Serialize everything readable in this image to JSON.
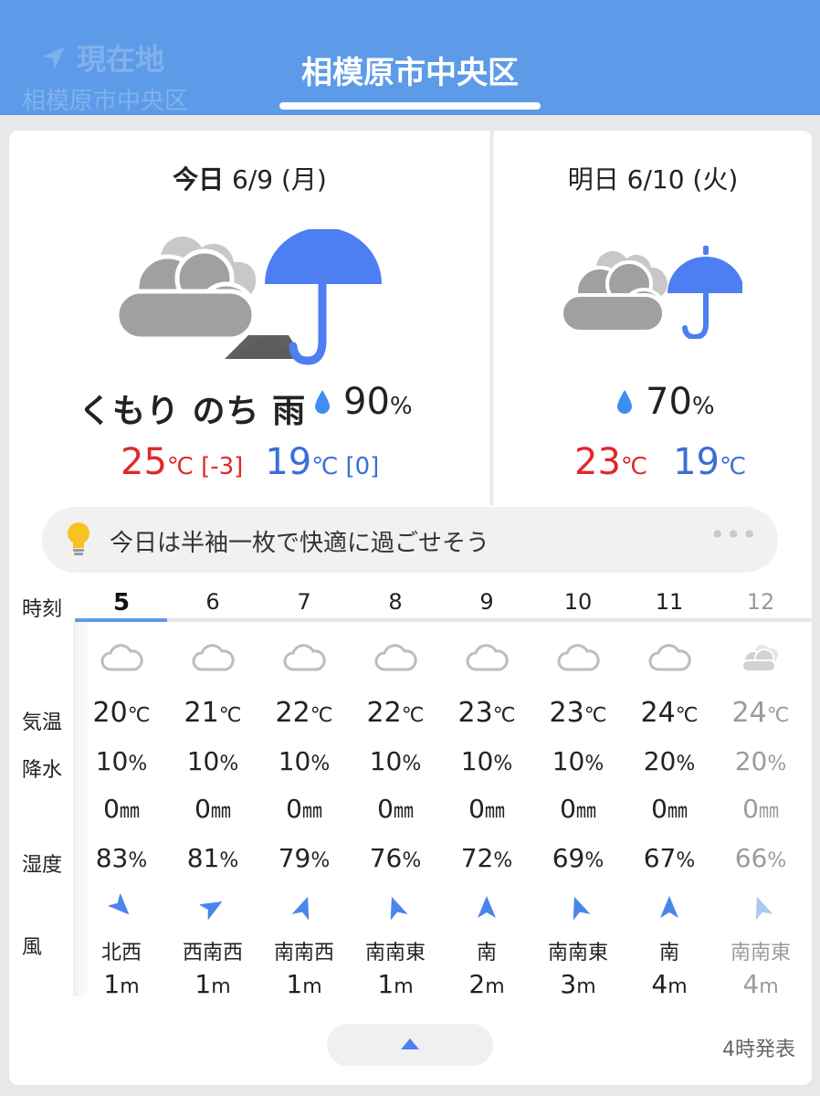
{
  "header": {
    "current_location_label": "現在地",
    "current_location_sub": "相模原市中央区",
    "title": "相模原市中央区"
  },
  "today": {
    "label_bold": "今日",
    "date": " 6/9 (月)",
    "weather": "くもり のち 雨",
    "precip_prob": "90",
    "precip_unit": "%",
    "high": "25",
    "high_diff": "[-3]",
    "low": "19",
    "low_diff": "[0]",
    "temp_unit": "℃"
  },
  "tomorrow": {
    "label": "明日 6/10 (火)",
    "precip_prob": "70",
    "precip_unit": "%",
    "high": "23",
    "low": "19",
    "temp_unit": "℃"
  },
  "advice": {
    "text": "今日は半袖一枚で快適に過ごせそう",
    "more": "•••"
  },
  "hourly": {
    "labels": {
      "time": "時刻",
      "temp": "気温",
      "precip": "降水",
      "humidity": "湿度",
      "wind": "風"
    },
    "hours": [
      {
        "hour": "5",
        "temp": "20",
        "precip": "10",
        "rain": "0",
        "humidity": "83",
        "wind_dir": "北西",
        "wind_speed": "1"
      },
      {
        "hour": "6",
        "temp": "21",
        "precip": "10",
        "rain": "0",
        "humidity": "81",
        "wind_dir": "西南西",
        "wind_speed": "1"
      },
      {
        "hour": "7",
        "temp": "22",
        "precip": "10",
        "rain": "0",
        "humidity": "79",
        "wind_dir": "南南西",
        "wind_speed": "1"
      },
      {
        "hour": "8",
        "temp": "22",
        "precip": "10",
        "rain": "0",
        "humidity": "76",
        "wind_dir": "南南東",
        "wind_speed": "1"
      },
      {
        "hour": "9",
        "temp": "23",
        "precip": "10",
        "rain": "0",
        "humidity": "72",
        "wind_dir": "南",
        "wind_speed": "2"
      },
      {
        "hour": "10",
        "temp": "23",
        "precip": "10",
        "rain": "0",
        "humidity": "69",
        "wind_dir": "南南東",
        "wind_speed": "3"
      },
      {
        "hour": "11",
        "temp": "24",
        "precip": "20",
        "rain": "0",
        "humidity": "67",
        "wind_dir": "南",
        "wind_speed": "4"
      },
      {
        "hour": "12",
        "temp": "24",
        "precip": "20",
        "rain": "0",
        "humidity": "66",
        "wind_dir": "南南東",
        "wind_speed": "4"
      }
    ],
    "units": {
      "temp": "℃",
      "precip": "%",
      "rain": "㎜",
      "humidity": "%",
      "wind": "m"
    }
  },
  "footer": {
    "issued": "4時発表"
  },
  "colors": {
    "header_bg": "#5d9be8",
    "high_temp": "#e0282a",
    "low_temp": "#3a6fd8",
    "umbrella": "#4d7ef2",
    "wind_arrow": "#4a86ea"
  },
  "icons": {
    "today": "cloudy-then-rain-icon",
    "tomorrow": "cloudy-rain-icon",
    "hourly": "cloud-icon",
    "precip": "raindrop-icon",
    "advice": "lightbulb-icon",
    "collapse": "chevron-up-icon"
  }
}
